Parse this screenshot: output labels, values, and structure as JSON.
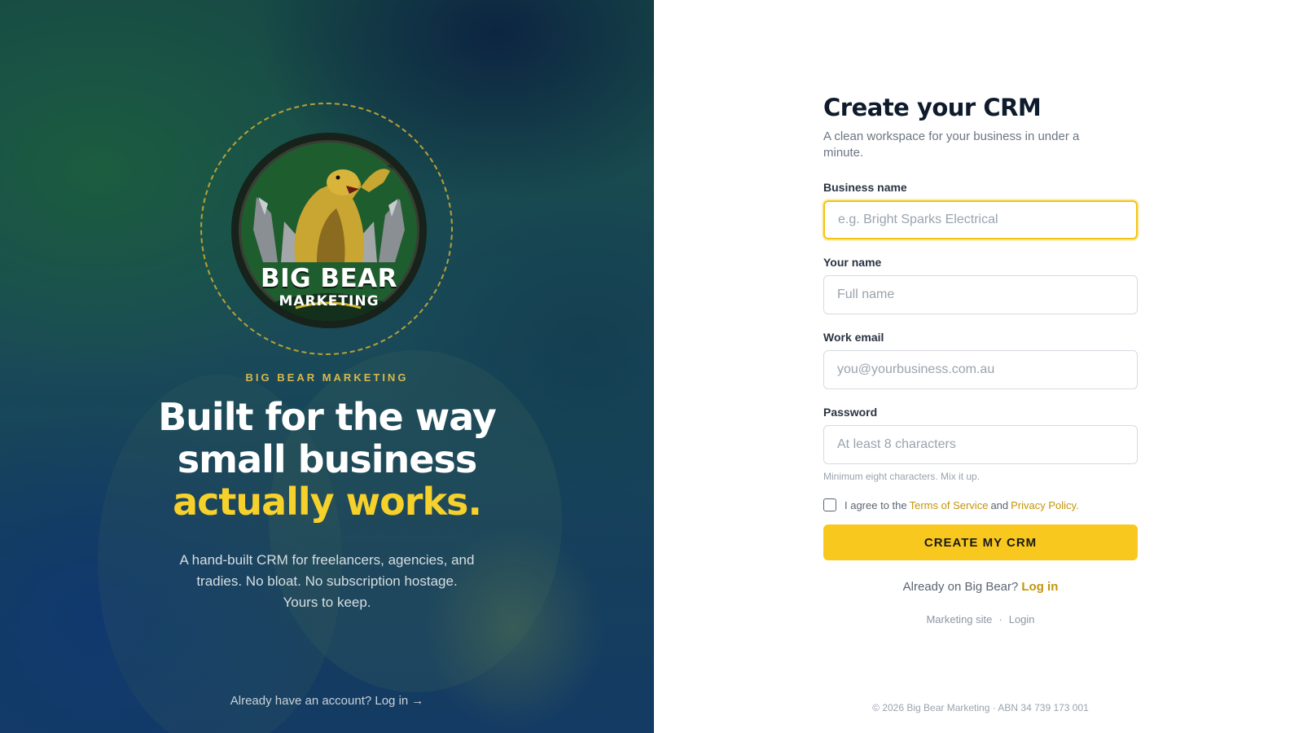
{
  "brand": {
    "logo_line_1": "BIG BEAR",
    "logo_line_2": "MARKETING",
    "eyebrow": "BIG BEAR MARKETING"
  },
  "hero": {
    "headline_line_1": "Built for the way",
    "headline_line_2": "small business",
    "headline_highlight": "actually works.",
    "sub_line_1": "A hand-built CRM for freelancers, agencies, and",
    "sub_line_2": "tradies. No bloat. No subscription hostage.",
    "sub_line_3": "Yours to keep.",
    "bottom_link": "Already have an account? Log in",
    "bottom_link_arrow": "→"
  },
  "form": {
    "title": "Create your CRM",
    "lead": "A clean workspace for your business in under a minute.",
    "fields": [
      {
        "label": "Business name",
        "placeholder": "e.g. Bright Sparks Electrical"
      },
      {
        "label": "Your name",
        "placeholder": "Full name"
      },
      {
        "label": "Work email",
        "placeholder": "you@yourbusiness.com.au"
      },
      {
        "label": "Password",
        "placeholder": "At least 8 characters"
      }
    ],
    "password_hint": "Minimum eight characters. Mix it up.",
    "agree_prefix": "I agree to the",
    "terms_link": "Terms of Service",
    "agree_and": "and",
    "privacy_link": "Privacy Policy.",
    "submit_label": "CREATE MY CRM",
    "already_text": "Already on Big Bear?",
    "login_link": "Log in"
  },
  "footer": {
    "marketing_link": "Marketing site",
    "separator": "·",
    "login_link": "Login",
    "copyright": "© 2026 Big Bear Marketing · ABN 34 739 173 001"
  },
  "colors": {
    "accent": "#f8c81f",
    "link": "#c2960a",
    "heading": "#0e1b2c"
  }
}
